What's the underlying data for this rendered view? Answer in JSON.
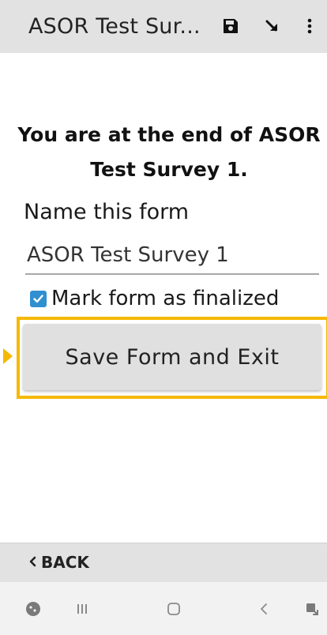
{
  "app_bar": {
    "title": "ASOR Test Sur...",
    "icons": [
      "save-icon",
      "jump-icon",
      "overflow-menu-icon"
    ]
  },
  "form_end": {
    "message_line1": "You are at the end of ASOR",
    "message_line2": "Test Survey 1.",
    "name_label": "Name this form",
    "name_value": "ASOR Test Survey 1",
    "finalize_label": "Mark form as finalized",
    "finalize_checked": true,
    "save_label": "Save Form and Exit"
  },
  "bottom_bar": {
    "back_label": "BACK"
  },
  "system_nav": {
    "icons": [
      "assistant-icon",
      "recent-apps-icon",
      "home-icon",
      "back-nav-icon",
      "screenshot-icon"
    ]
  },
  "colors": {
    "app_bar_bg": "#e2e2e2",
    "highlight": "#f5b800",
    "checkbox": "#2f8fd0",
    "button_bg": "#e0e0e0"
  }
}
